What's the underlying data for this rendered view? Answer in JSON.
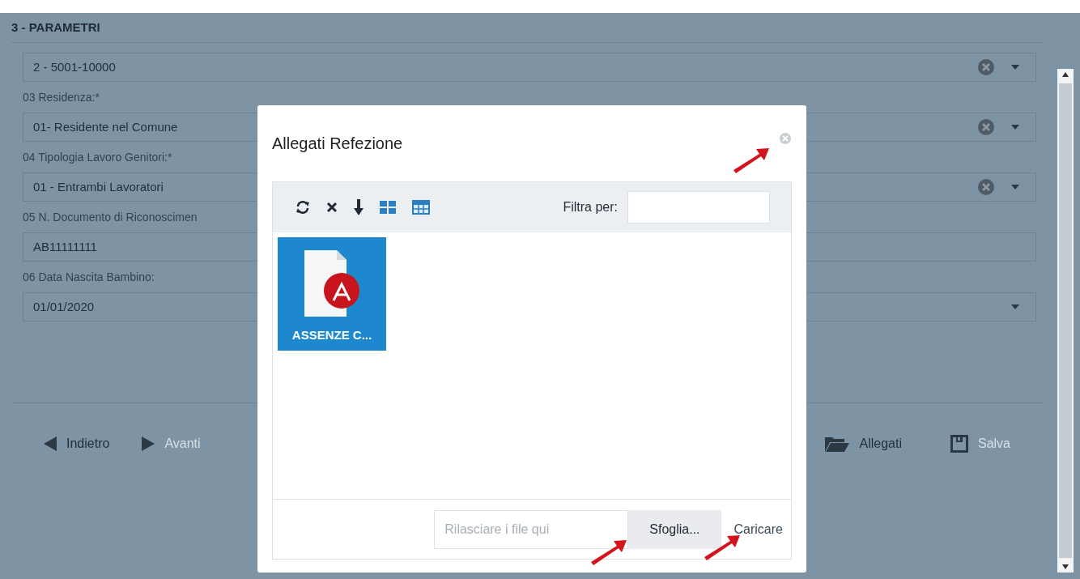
{
  "form": {
    "title": "3 - PARAMETRI",
    "fields": [
      {
        "kind": "select",
        "value": "2 - 5001-10000",
        "clearable": true
      },
      {
        "kind": "select",
        "label": "03 Residenza:*",
        "value": "01- Residente nel Comune",
        "clearable": true
      },
      {
        "kind": "select",
        "label": "04 Tipologia Lavoro Genitori:*",
        "value": "01 - Entrambi Lavoratori",
        "clearable": true
      },
      {
        "kind": "text",
        "label": "05 N. Documento di Riconoscimen",
        "value": "AB11111111"
      },
      {
        "kind": "date",
        "label": "06 Data Nascita Bambino:",
        "value": "01/01/2020"
      }
    ],
    "footer_buttons": [
      {
        "kind": "back",
        "label": "Indietro",
        "disabled": false
      },
      {
        "kind": "forward",
        "label": "Avanti",
        "disabled": true
      },
      {
        "kind": "attachments",
        "label": "Allegati",
        "disabled": false
      },
      {
        "kind": "save",
        "label": "Salva",
        "disabled": true
      }
    ]
  },
  "dialog": {
    "title": "Allegati Refezione",
    "toolbar": [
      {
        "kind": "refresh"
      },
      {
        "kind": "delete"
      },
      {
        "kind": "download"
      },
      {
        "kind": "grid"
      },
      {
        "kind": "table"
      }
    ],
    "filter_label": "Filtra per:",
    "files": [
      {
        "name": "ASSENZE C...",
        "selected": true
      }
    ],
    "drop_placeholder": "Rilasciare i file qui",
    "browse_button": "Sfoglia...",
    "upload_button": "Caricare"
  }
}
